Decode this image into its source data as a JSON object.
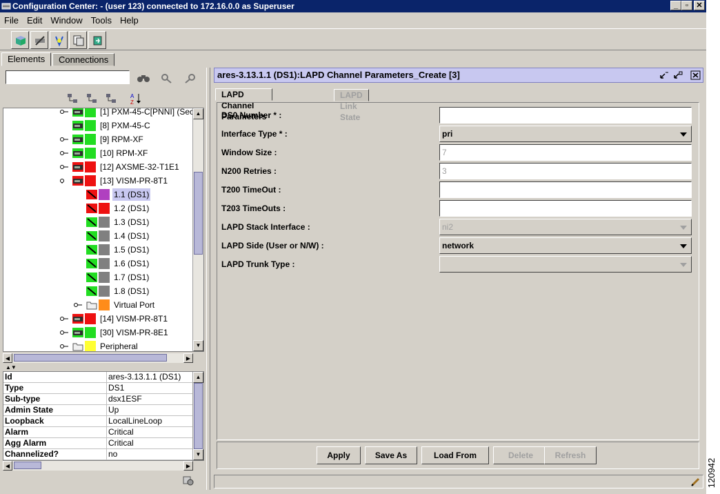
{
  "window": {
    "title": "Configuration Center: - (user 123) connected to 172.16.0.0 as Superuser",
    "minimize": "_",
    "maximize": "▫",
    "close": "✕"
  },
  "menu": [
    "File",
    "Edit",
    "Window",
    "Tools",
    "Help"
  ],
  "toolbar_icons": [
    "cube-icon",
    "tools-icon",
    "diagnostics-icon",
    "copy-icon",
    "export-icon"
  ],
  "top_tabs": [
    "Elements",
    "Connections"
  ],
  "search": {
    "value": ""
  },
  "tree": [
    {
      "label": "[1] PXM-45-C[PNNI] (Sec",
      "state": "green"
    },
    {
      "label": "[8] PXM-45-C",
      "state": "green"
    },
    {
      "label": "[9] RPM-XF",
      "state": "green"
    },
    {
      "label": "[10] RPM-XF",
      "state": "green"
    },
    {
      "label": "[12] AXSME-32-T1E1",
      "state": "red"
    },
    {
      "label": "[13] VISM-PR-8T1",
      "state": "red"
    },
    {
      "label": "1.1  (DS1)",
      "state": "purple",
      "selected": true
    },
    {
      "label": "1.2  (DS1)",
      "state": "red"
    },
    {
      "label": "1.3  (DS1)",
      "state": "gray"
    },
    {
      "label": "1.4  (DS1)",
      "state": "gray"
    },
    {
      "label": "1.5  (DS1)",
      "state": "gray"
    },
    {
      "label": "1.6  (DS1)",
      "state": "gray"
    },
    {
      "label": "1.7  (DS1)",
      "state": "gray"
    },
    {
      "label": "1.8  (DS1)",
      "state": "gray"
    },
    {
      "label": "Virtual Port",
      "state": "orange"
    },
    {
      "label": "[14] VISM-PR-8T1",
      "state": "red"
    },
    {
      "label": "[30] VISM-PR-8E1",
      "state": "green"
    },
    {
      "label": "Peripheral",
      "state": "yellow"
    }
  ],
  "properties": [
    {
      "key": "Id",
      "value": "ares-3.13.1.1  (DS1)"
    },
    {
      "key": "Type",
      "value": "DS1"
    },
    {
      "key": "Sub-type",
      "value": "dsx1ESF"
    },
    {
      "key": "Admin State",
      "value": "Up"
    },
    {
      "key": "Loopback",
      "value": "LocalLineLoop"
    },
    {
      "key": "Alarm",
      "value": "Critical"
    },
    {
      "key": "Agg Alarm",
      "value": "Critical"
    },
    {
      "key": "Channelized?",
      "value": "no"
    }
  ],
  "panel": {
    "title": "ares-3.13.1.1  (DS1):LAPD Channel Parameters_Create [3]",
    "tabs": [
      "LAPD Channel Parameters",
      "LAPD Link State"
    ],
    "fields": [
      {
        "label": "DS0 Number * :",
        "kind": "input",
        "value": "",
        "disabled": false
      },
      {
        "label": "Interface Type * :",
        "kind": "select",
        "value": "pri",
        "disabled": false
      },
      {
        "label": "Window Size :",
        "kind": "input",
        "value": "7",
        "disabled": true
      },
      {
        "label": "N200 Retries :",
        "kind": "input",
        "value": "3",
        "disabled": true
      },
      {
        "label": "T200 TimeOut :",
        "kind": "input",
        "value": "",
        "disabled": false
      },
      {
        "label": "T203 TimeOuts :",
        "kind": "input",
        "value": "",
        "disabled": false
      },
      {
        "label": "LAPD Stack Interface :",
        "kind": "select",
        "value": "ni2",
        "disabled": true
      },
      {
        "label": "LAPD Side (User or N/W) :",
        "kind": "select",
        "value": "network",
        "disabled": false
      },
      {
        "label": "LAPD Trunk Type :",
        "kind": "select",
        "value": "",
        "disabled": true
      }
    ],
    "buttons": [
      {
        "label": "Apply",
        "disabled": false
      },
      {
        "label": "Save As",
        "disabled": false
      },
      {
        "label": "Load From",
        "disabled": false
      },
      {
        "label": "Delete",
        "disabled": true
      },
      {
        "label": "Refresh",
        "disabled": true
      }
    ]
  },
  "figure_id": "120942",
  "colors": {
    "green": "#22dd22",
    "red": "#ee1111",
    "gray": "#808080",
    "purple": "#b040c0",
    "orange": "#ff8c1a",
    "yellow": "#ffff33",
    "selection": "#c8c8f0"
  }
}
